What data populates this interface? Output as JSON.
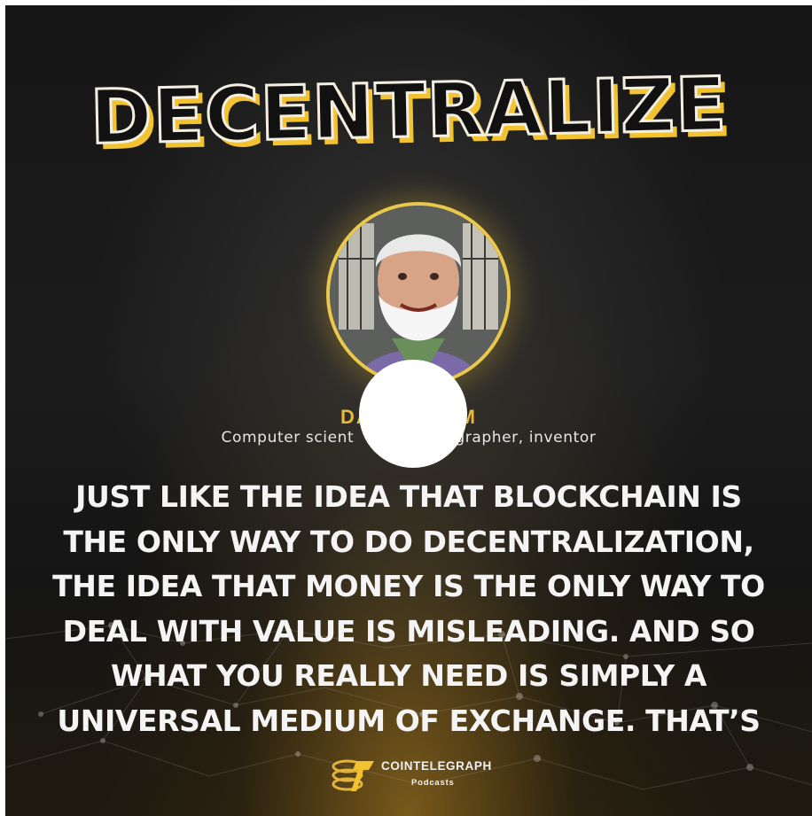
{
  "colors": {
    "accent": "#f2c230",
    "name": "#e7b93a",
    "text": "#f4f4f4",
    "background": "#1a1a1a"
  },
  "header": {
    "title": "DECENTRALIZE"
  },
  "speaker": {
    "name": "DAV        UM",
    "role": "Computer scient                   grapher, inventor",
    "avatar_icon": "portrait-illustration"
  },
  "quote": {
    "lines": [
      "JUST LIKE THE IDEA THAT BLOCKCHAIN IS",
      "THE ONLY WAY TO DO DECENTRALIZATION,",
      "THE IDEA THAT MONEY IS THE ONLY WAY TO",
      "DEAL WITH VALUE IS MISLEADING. AND SO",
      "WHAT YOU REALLY NEED IS SIMPLY A",
      "UNIVERSAL MEDIUM OF EXCHANGE. THAT’S"
    ]
  },
  "brand": {
    "name": "COINTELEGRAPH",
    "sub": "Podcasts",
    "icon": "cointelegraph-logo-icon"
  }
}
